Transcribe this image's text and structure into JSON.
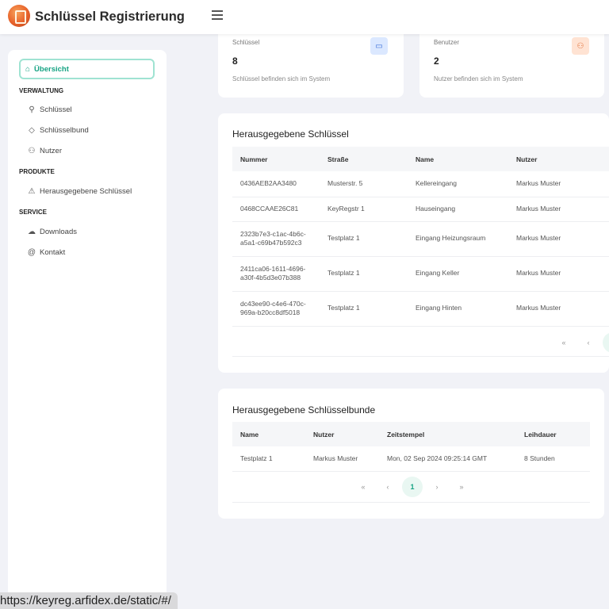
{
  "app": {
    "title": "Schlüssel Registrierung"
  },
  "sidebar": {
    "active": "Übersicht",
    "sections": [
      "VERWALTUNG",
      "PRODUKTE",
      "SERVICE"
    ],
    "verwaltung": [
      "Schlüssel",
      "Schlüsselbund",
      "Nutzer"
    ],
    "produkte": [
      "Herausgegebene Schlüssel"
    ],
    "service": [
      "Downloads",
      "Kontakt"
    ]
  },
  "stats": {
    "keys": {
      "label": "Schlüssel",
      "value": "8",
      "desc": "Schlüssel befinden sich im System"
    },
    "users": {
      "label": "Benutzer",
      "value": "2",
      "desc": "Nutzer befinden sich im System"
    }
  },
  "keys_table": {
    "title": "Herausgegebene Schlüssel",
    "headers": [
      "Nummer",
      "Straße",
      "Name",
      "Nutzer"
    ],
    "rows": [
      [
        "0436AEB2AA3480",
        "Musterstr. 5",
        "Kellereingang",
        "Markus Muster"
      ],
      [
        "0468CCAAE26C81",
        "KeyRegstr 1",
        "Hauseingang",
        "Markus Muster"
      ],
      [
        "2323b7e3-c1ac-4b6c-a5a1-c69b47b592c3",
        "Testplatz 1",
        "Eingang Heizungsraum",
        "Markus Muster"
      ],
      [
        "2411ca06-1611-4696-a30f-4b5d3e07b388",
        "Testplatz 1",
        "Eingang Keller",
        "Markus Muster"
      ],
      [
        "dc43ee90-c4e6-470c-969a-b20cc8df5018",
        "Testplatz 1",
        "Eingang Hinten",
        "Markus Muster"
      ]
    ],
    "pager": [
      "«",
      "‹"
    ]
  },
  "bunches_table": {
    "title": "Herausgegebene Schlüsselbunde",
    "headers": [
      "Name",
      "Nutzer",
      "Zeitstempel",
      "Leihdauer"
    ],
    "rows": [
      [
        "Testplatz 1",
        "Markus Muster",
        "Mon, 02 Sep 2024 09:25:14 GMT",
        "8 Stunden"
      ]
    ],
    "pager": [
      "«",
      "‹",
      "1",
      "›",
      "»"
    ]
  },
  "statusbar": {
    "url": "https://keyreg.arfidex.de/static/#/"
  },
  "colors": {
    "accent": "#16a383",
    "blue_badge": "#dbe8ff",
    "orange_badge": "#ffe3d3"
  }
}
